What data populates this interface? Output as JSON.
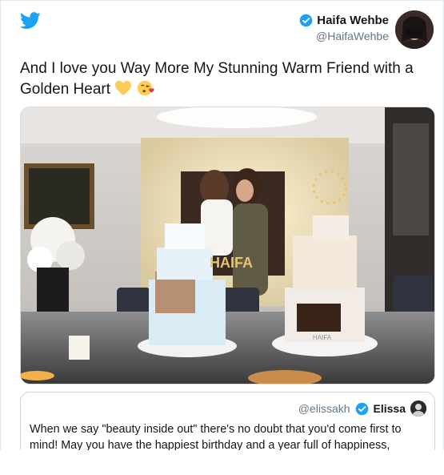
{
  "tweet": {
    "author_name": "Haifa Wehbe",
    "author_handle": "@HaifaWehbe",
    "text": "And I love you Way More My Stunning Warm Friend with a Golden Heart",
    "emojis": [
      "yellow-heart",
      "face-blowing-kiss"
    ]
  },
  "photo": {
    "cake_text_left": "HAIFA",
    "cake_text_right": "HAIFA"
  },
  "quoted_tweet": {
    "author_handle": "@elissakh",
    "author_name": "Elissa",
    "text": "When we say \"beauty inside out\" there's no doubt that you'd come first to mind! May you have the happiest birthday and a year full of happiness,"
  },
  "colors": {
    "twitter_blue": "#1da1f2",
    "text": "#14171a",
    "muted": "#657786",
    "border": "#e1e8ed"
  }
}
